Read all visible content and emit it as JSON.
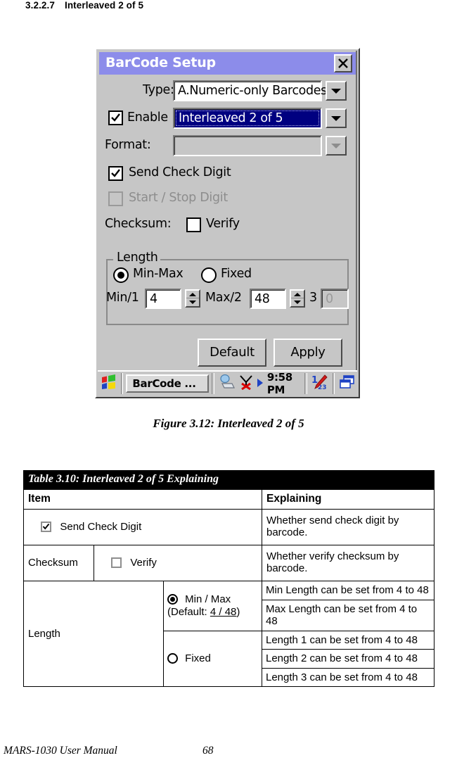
{
  "heading": {
    "number": "3.2.2.7",
    "title": "Interleaved 2 of 5"
  },
  "dialog": {
    "title": "BarCode Setup",
    "close_icon": "close-x-icon",
    "type_label": "Type:",
    "type_value": "A.Numeric-only Barcodes",
    "enable_label": "Enable",
    "enable_checked": "checked",
    "enable_value": "Interleaved 2 of 5",
    "format_label": "Format:",
    "format_value": "",
    "send_check_digit_label": "Send Check Digit",
    "start_stop_digit_label": "Start / Stop Digit",
    "checksum_label": "Checksum:",
    "verify_label": "Verify",
    "length_group_label": "Length",
    "min_max_label": "Min-Max",
    "fixed_label": "Fixed",
    "min1_label": "Min/1",
    "min1_value": "4",
    "max2_label": "Max/2",
    "max2_value": "48",
    "third_label": "3",
    "third_value": "0",
    "default_button": "Default",
    "apply_button": "Apply",
    "colors": {
      "titlebar": "#8c8cea",
      "face": "#c6c6c6",
      "selection": "#000080"
    }
  },
  "taskbar": {
    "start_icon": "windows-start-icon",
    "task_label": "BarCode ...",
    "network_icon": "network-connection-icon",
    "no_signal_icon": "no-signal-icon",
    "play_icon": "play-triangle-icon",
    "clock": "9:58 PM",
    "input_panel_icon": "input-panel-pencil-icon",
    "desktop_icon": "switch-windows-icon"
  },
  "figure_caption": "Figure 3.12: Interleaved 2 of 5",
  "table": {
    "caption": "Table 3.10: Interleaved 2 of 5 Explaining",
    "headers": [
      "Item",
      "Explaining"
    ],
    "rows": [
      {
        "item_checkbox": "checked",
        "item_label": "Send Check Digit",
        "explaining": "Whether send check digit by barcode."
      },
      {
        "group_label": "Checksum",
        "item_checkbox": "unchecked",
        "item_label": "Verify",
        "explaining": "Whether verify checksum by barcode."
      }
    ],
    "length_group_label": "Length",
    "length_options": [
      {
        "radio": "selected",
        "label": "Min / Max",
        "default_prefix": "(Default: ",
        "default_value": "4 / 48",
        "default_suffix": ")",
        "explaining": [
          "Min Length can be set from 4 to 48",
          "Max Length can be set from 4 to 48"
        ]
      },
      {
        "radio": "unselected",
        "label": "Fixed",
        "explaining": [
          "Length 1 can be set from 4 to 48",
          "Length 2 can be set from 4 to 48",
          "Length 3 can be set from 4 to 48"
        ]
      }
    ]
  },
  "footer": {
    "manual": "MARS-1030 User Manual",
    "page": "68"
  }
}
